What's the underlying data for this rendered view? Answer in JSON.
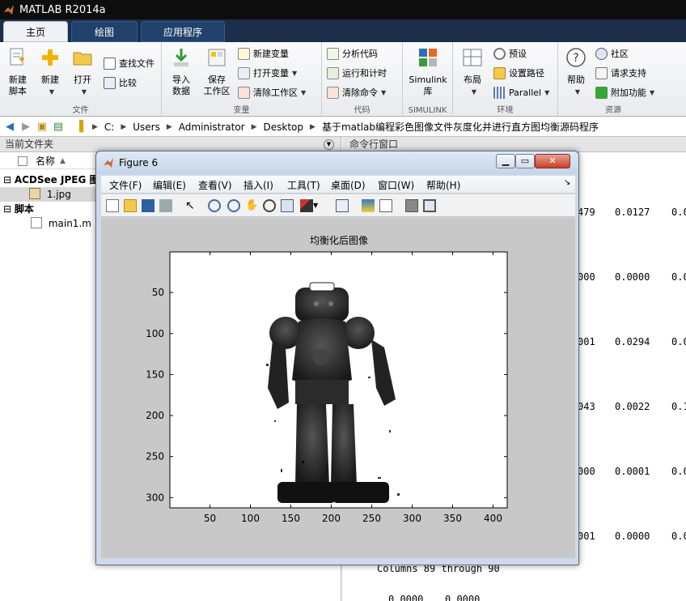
{
  "app": {
    "title": "MATLAB R2014a"
  },
  "tabs": [
    {
      "label": "主页"
    },
    {
      "label": "绘图"
    },
    {
      "label": "应用程序"
    }
  ],
  "ribbon": {
    "file": {
      "label": "文件",
      "new_script": [
        "新建",
        "脚本"
      ],
      "new": "新建",
      "open": "打开",
      "find_files": "查找文件",
      "compare": "比较"
    },
    "variable": {
      "label": "变量",
      "import": [
        "导入",
        "数据"
      ],
      "save_ws": [
        "保存",
        "工作区"
      ],
      "new_var": "新建变量",
      "open_var": "打开变量",
      "clear_ws": "清除工作区"
    },
    "code": {
      "label": "代码",
      "analyze": "分析代码",
      "run_time": "运行和计时",
      "clear_cmd": "清除命令"
    },
    "simulink": {
      "label": "SIMULINK",
      "btn": [
        "Simulink",
        "库"
      ]
    },
    "env": {
      "label": "环境",
      "layout": "布局",
      "prefs": "预设",
      "set_path": "设置路径",
      "parallel": "Parallel"
    },
    "resources": {
      "label": "资源",
      "help": "帮助",
      "community": "社区",
      "support": "请求支持",
      "addons": "附加功能"
    }
  },
  "address": {
    "segments": [
      "C:",
      "Users",
      "Administrator",
      "Desktop",
      "基于matlab编程彩色图像文件灰度化并进行直方图均衡源码程序"
    ]
  },
  "folder_panel": {
    "title": "当前文件夹",
    "col_name": "名称",
    "col_sort": "▲",
    "groups": [
      {
        "label": "ACDSee JPEG 图",
        "items": [
          "1.jpg"
        ]
      },
      {
        "label": "脚本",
        "items": [
          "main1.m"
        ]
      }
    ]
  },
  "command_window": {
    "title": "命令行窗口",
    "rows": [
      [
        "479",
        "0.0127",
        "0.0"
      ],
      [
        "000",
        "0.0000",
        "0.0"
      ],
      [
        "001",
        "0.0294",
        "0.0"
      ],
      [
        "043",
        "0.0022",
        "0.1"
      ],
      [
        "000",
        "0.0001",
        "0.0"
      ],
      [
        "001",
        "0.0000",
        "0.0"
      ]
    ],
    "columns_line": "Columns 89 through 90",
    "last_line": [
      "0.0000",
      "0.0000"
    ]
  },
  "figure": {
    "title": "Figure 6",
    "menus": [
      "文件(F)",
      "编辑(E)",
      "查看(V)",
      "插入(I)",
      "工具(T)",
      "桌面(D)",
      "窗口(W)",
      "帮助(H)"
    ],
    "plot_title": "均衡化后图像",
    "x_ticks": [
      50,
      100,
      150,
      200,
      250,
      300,
      350,
      400
    ],
    "y_ticks": [
      50,
      100,
      150,
      200,
      250,
      300
    ],
    "x_range": [
      0.5,
      417.5
    ],
    "y_range": [
      0.5,
      312.5
    ]
  },
  "colors": {
    "title_bg": "#0d0d0d",
    "tab_bg": "#1c2e4a",
    "figure_frame": "#cfdae8"
  }
}
